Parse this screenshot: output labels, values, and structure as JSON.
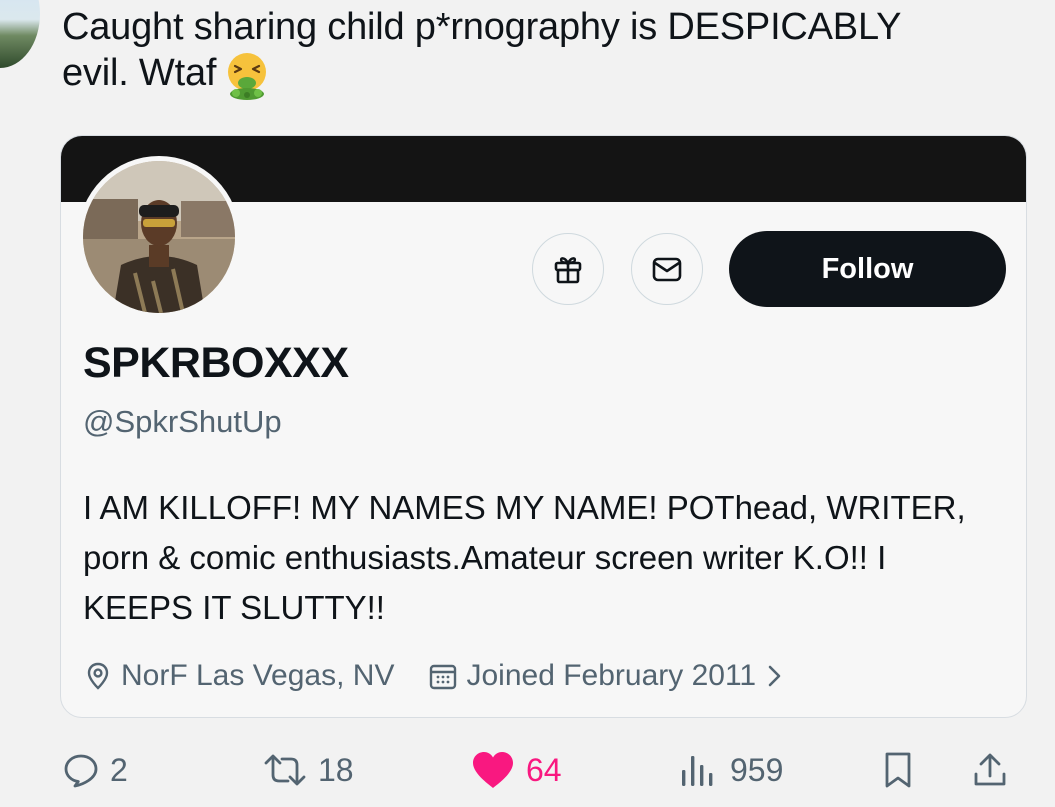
{
  "tweet": {
    "text": "Caught sharing child p*rnography is DESPICABLY evil. Wtaf",
    "emoji": "vomiting-face"
  },
  "profile_card": {
    "display_name": "SPKRBOXXX",
    "handle": "@SpkrShutUp",
    "bio": "I AM KILLOFF! MY NAMES MY NAME! POThead, WRITER, porn & comic enthusiasts.Amateur screen writer K.O!! I KEEPS IT SLUTTY!!",
    "location": "NorF Las Vegas, NV",
    "joined": "Joined February 2011",
    "follow_label": "Follow",
    "icons": {
      "gift": "gift-icon",
      "message": "envelope-icon",
      "location": "location-pin-icon",
      "calendar": "calendar-icon"
    }
  },
  "actions": {
    "replies": "2",
    "reposts": "18",
    "likes": "64",
    "views": "959"
  },
  "colors": {
    "background": "#f2f2f2",
    "text_primary": "#0f1419",
    "text_secondary": "#536471",
    "like_accent": "#f91880",
    "follow_button": "#0f1419",
    "banner": "#141414"
  }
}
